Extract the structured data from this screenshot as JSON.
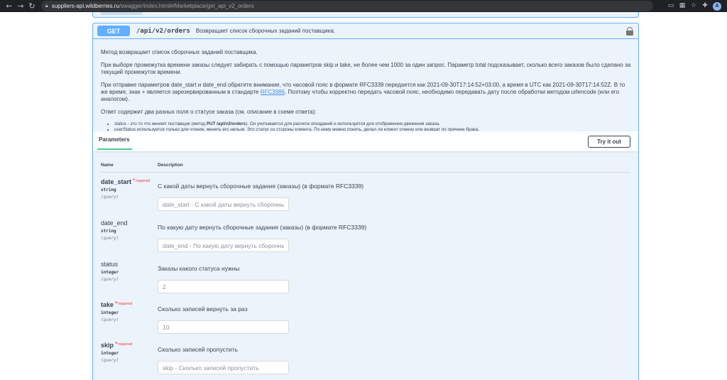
{
  "browser": {
    "url_host": "suppliers-api.wildberries.ru",
    "url_path": "/swagger/index.html#/Marketplace/get_api_v2_orders",
    "avatar_letter": "A"
  },
  "operation": {
    "method": "GET",
    "path": "/api/v2/orders",
    "summary": "Возвращает список сборочных заданий поставщика."
  },
  "description": {
    "p1": "Метод возвращает список сборочных заданий поставщика.",
    "p2": "При выборе промежутка времени заказы следует забирать с помощью параметров skip и take, не более чем 1000 за один запрос. Параметр total подсказывает, сколько всего заказов было сделано за текущий промежуток времени.",
    "p3_before": "При отправке параметров date_start и date_end обратите внимание, что часовой пояс в формате RFC3339 передается как 2021-09-30T17:14:52+03:00, а время в UTC как 2021-09-30T17:14:52Z. В то же время, знак + является зарезервированным в стандарте ",
    "p3_link": "RFC3986",
    "p3_after": ". Поэтому чтобы корректно передать часовой пояс, необходимо передавать дату после обработки методом urlencode (или его аналогом).",
    "p4": "Ответ содержит два разных поля о статусе заказа (см. описание в схеме ответа):",
    "li1_before": "status - это то что меняет поставщик (метод ",
    "li1_bold": "PUT /api/v2/orders",
    "li1_after": "). Он учитывается для расчета опозданий и используется для отображения движения заказа.",
    "li2": "userStatus используется только для чтения, менять его нельзя. Это статус со стороны клиента. По нему можно понять, делал ли клиент отмену или возврат по причине брака."
  },
  "params_section": {
    "tab_label": "Parameters",
    "try_button": "Try it out",
    "col_name": "Name",
    "col_desc": "Description"
  },
  "required_mark": "*",
  "required_label": "required",
  "parameters": [
    {
      "name": "date_start",
      "required": true,
      "type": "string",
      "in": "(query)",
      "description": "С какой даты вернуть сборочные задания (заказы) (в формате RFC3339)",
      "placeholder": "date_start - С какой даты вернуть сборочные задания (заказы) (в формате RFC3339)",
      "value": ""
    },
    {
      "name": "date_end",
      "required": false,
      "type": "string",
      "in": "(query)",
      "description": "По какую дату вернуть сборочные задания (заказы) (в формате RFC3339)",
      "placeholder": "date_end - По какую дату вернуть сборочные задания (заказы) (в формате RFC3339)",
      "value": ""
    },
    {
      "name": "status",
      "required": false,
      "type": "integer",
      "in": "(query)",
      "description": "Заказы какого статуса нужны",
      "placeholder": "2",
      "value": ""
    },
    {
      "name": "take",
      "required": true,
      "type": "integer",
      "in": "(query)",
      "description": "Сколько записей вернуть за раз",
      "placeholder": "10",
      "value": ""
    },
    {
      "name": "skip",
      "required": true,
      "type": "integer",
      "in": "(query)",
      "description": "Сколько записей пропустить",
      "placeholder": "skip - Сколько записей пропустить",
      "value": ""
    }
  ]
}
